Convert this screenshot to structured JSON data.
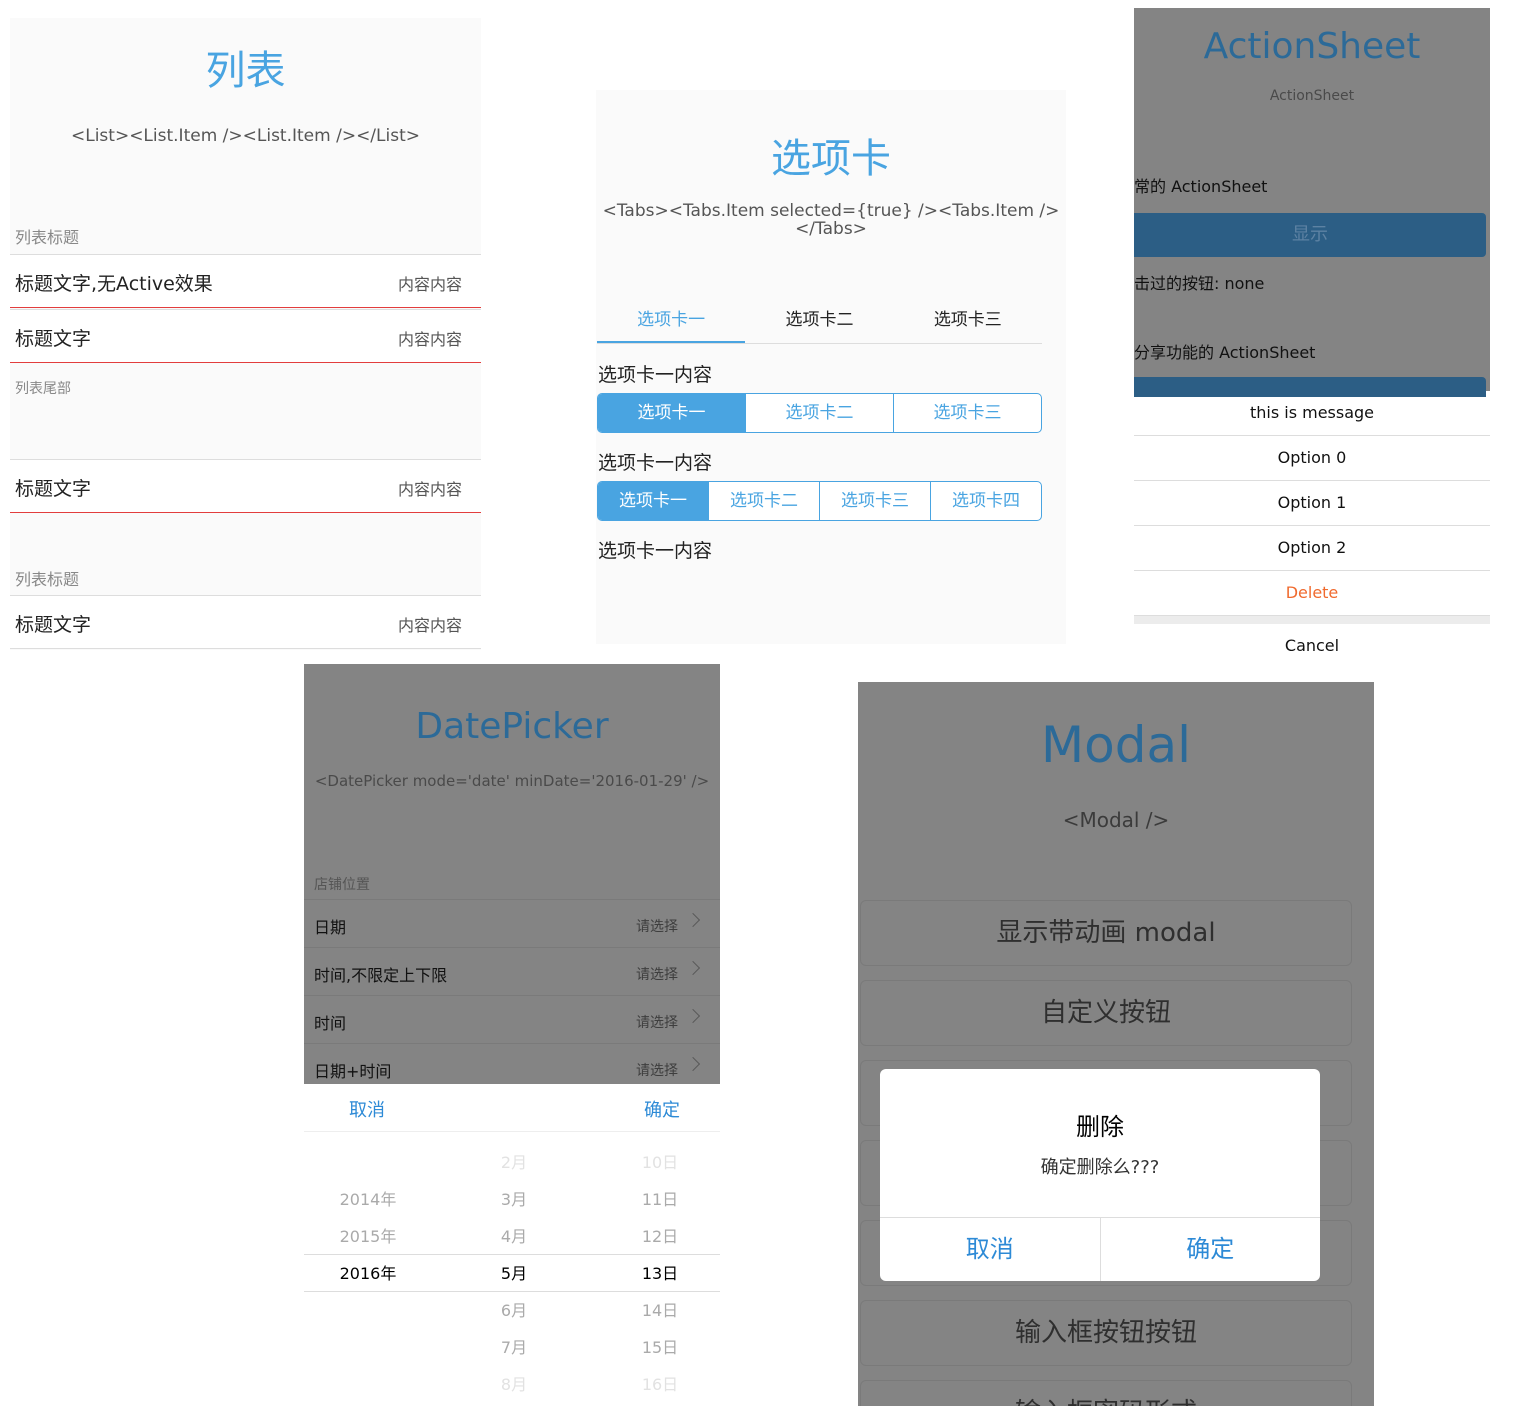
{
  "list": {
    "title": "列表",
    "subtitle": "<List><List.Item /><List.Item /></List>",
    "header1": "列表标题",
    "row1": {
      "label": "标题文字,无Active效果",
      "value": "内容内容"
    },
    "row2": {
      "label": "标题文字",
      "value": "内容内容"
    },
    "footer": "列表尾部",
    "row3": {
      "label": "标题文字",
      "value": "内容内容"
    },
    "header2": "列表标题",
    "row4": {
      "label": "标题文字",
      "value": "内容内容"
    }
  },
  "tabs": {
    "title": "选项卡",
    "subtitle": "<Tabs><Tabs.Item selected={true} /><Tabs.Item /></Tabs>",
    "underline_tabs": [
      "选项卡一",
      "选项卡二",
      "选项卡三"
    ],
    "content": "选项卡一内容",
    "seg3": [
      "选项卡一",
      "选项卡二",
      "选项卡三"
    ],
    "seg4": [
      "选项卡一",
      "选项卡二",
      "选项卡三",
      "选项卡四"
    ]
  },
  "actionsheet": {
    "title": "ActionSheet",
    "subtitle": "ActionSheet",
    "label1": "常的 ActionSheet",
    "show_button": "显示",
    "clicked": "击过的按钮: none",
    "label2": "分享功能的 ActionSheet",
    "message": "this is message",
    "options": [
      "Option 0",
      "Option 1",
      "Option 2"
    ],
    "delete": "Delete",
    "cancel": "Cancel"
  },
  "datepicker": {
    "title": "DatePicker",
    "subtitle": "<DatePicker mode='date' minDate='2016-01-29' />",
    "header": "店铺位置",
    "rows": [
      {
        "label": "日期",
        "value": "请选择"
      },
      {
        "label": "时间,不限定上下限",
        "value": "请选择"
      },
      {
        "label": "时间",
        "value": "请选择"
      },
      {
        "label": "日期+时间",
        "value": "请选择"
      }
    ],
    "cancel": "取消",
    "confirm": "确定",
    "years": [
      "2014年",
      "2015年",
      "2016年"
    ],
    "months": [
      "2月",
      "3月",
      "4月",
      "5月",
      "6月",
      "7月",
      "8月"
    ],
    "days": [
      "10日",
      "11日",
      "12日",
      "13日",
      "14日",
      "15日",
      "16日"
    ]
  },
  "modal": {
    "title": "Modal",
    "subtitle": "<Modal />",
    "buttons": [
      "显示带动画 modal",
      "自定义按钮",
      "输入框按钮按钮",
      "输入框密码形式"
    ],
    "dialog": {
      "title": "删除",
      "message": "确定删除么???",
      "cancel": "取消",
      "confirm": "确定"
    }
  }
}
